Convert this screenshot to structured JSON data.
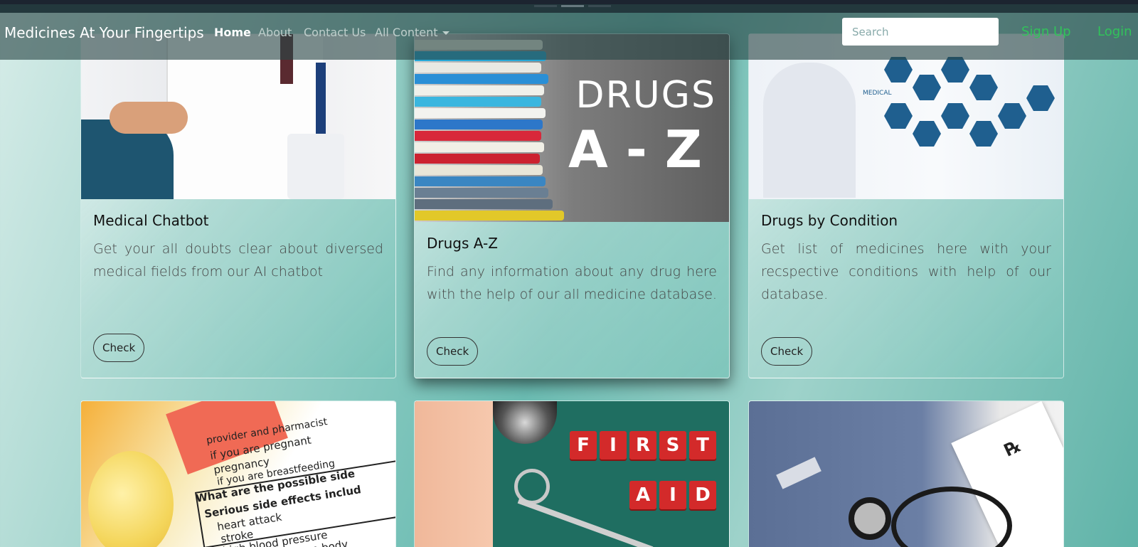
{
  "navbar": {
    "brand": "Medicines At Your Fingertips",
    "links": [
      "Home",
      "About",
      "Contact Us",
      "All Content"
    ],
    "search_placeholder": "Search",
    "sign_up": "Sign Up",
    "login": "Login"
  },
  "cards": [
    {
      "title": "Medical Chatbot",
      "text": "Get your all doubts clear about diversed medical fields from our AI chatbot",
      "button": "Check"
    },
    {
      "title": "Drugs A-Z",
      "text": "Find any information about any drug here with the help of our all medicine database.",
      "button": "Check",
      "image_text": [
        "DRUGS",
        "A - Z"
      ]
    },
    {
      "title": "Drugs by Condition",
      "text": "Get list of medicines here with your recspective conditions with help of our database.",
      "button": "Check"
    }
  ],
  "image_text": {
    "pills": [
      "provider and pharmacist",
      "if you are pregnant",
      "pregnancy",
      "if you are breastfeeding",
      "What are the possible side",
      "Serious side effects includ",
      "heart attack",
      "stroke",
      "high blood pressure",
      "heart failure from body"
    ],
    "first_aid": [
      "F",
      "I",
      "R",
      "S",
      "T",
      "A",
      "I",
      "D"
    ],
    "medical": "MEDICAL"
  },
  "colors": {
    "accent_green": "#31c35a",
    "navbar_bg": "rgba(40,70,70,0.62)",
    "teal": "#6bbcb2"
  }
}
